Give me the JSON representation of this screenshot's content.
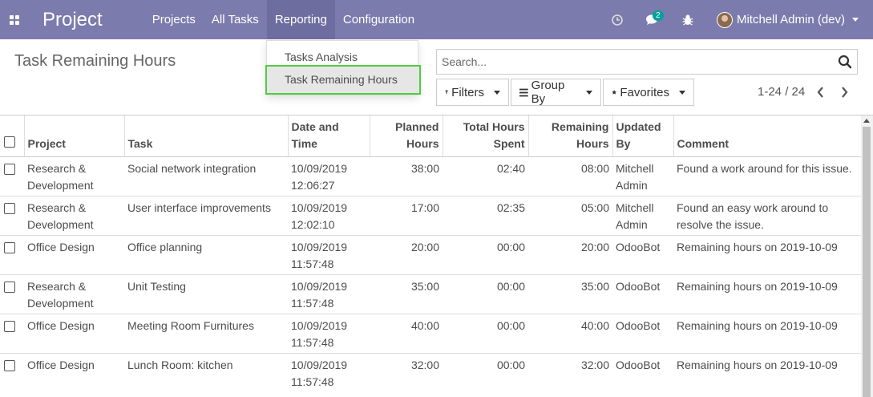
{
  "navbar": {
    "brand": "Project",
    "menu": [
      "Projects",
      "All Tasks",
      "Reporting",
      "Configuration"
    ],
    "chat_badge": "2",
    "user_name": "Mitchell Admin (dev)"
  },
  "reporting_menu": {
    "items": [
      "Tasks Analysis",
      "Task Remaining Hours"
    ]
  },
  "control_panel": {
    "title": "Task Remaining Hours",
    "search_placeholder": "Search...",
    "filters": "Filters",
    "group_by": "Group By",
    "favorites": "Favorites",
    "pager": "1-24 / 24"
  },
  "table": {
    "headers": {
      "project": "Project",
      "task": "Task",
      "date": "Date and Time",
      "planned": "Planned Hours",
      "spent": "Total Hours Spent",
      "remaining": "Remaining Hours",
      "updated": "Updated By",
      "comment": "Comment"
    },
    "rows": [
      {
        "project": "Research & Development",
        "task": "Social network integration",
        "date": "10/09/2019 12:06:27",
        "planned": "38:00",
        "spent": "02:40",
        "remaining": "08:00",
        "updated": "Mitchell Admin",
        "comment": "Found a work around for this issue."
      },
      {
        "project": "Research & Development",
        "task": "User interface improvements",
        "date": "10/09/2019 12:02:10",
        "planned": "17:00",
        "spent": "02:35",
        "remaining": "05:00",
        "updated": "Mitchell Admin",
        "comment": "Found an easy work around to resolve the issue."
      },
      {
        "project": "Office Design",
        "task": "Office planning",
        "date": "10/09/2019 11:57:48",
        "planned": "20:00",
        "spent": "00:00",
        "remaining": "20:00",
        "updated": "OdooBot",
        "comment": "Remaining hours on 2019-10-09"
      },
      {
        "project": "Research & Development",
        "task": "Unit Testing",
        "date": "10/09/2019 11:57:48",
        "planned": "35:00",
        "spent": "00:00",
        "remaining": "35:00",
        "updated": "OdooBot",
        "comment": "Remaining hours on 2019-10-09"
      },
      {
        "project": "Office Design",
        "task": "Meeting Room Furnitures",
        "date": "10/09/2019 11:57:48",
        "planned": "40:00",
        "spent": "00:00",
        "remaining": "40:00",
        "updated": "OdooBot",
        "comment": "Remaining hours on 2019-10-09"
      },
      {
        "project": "Office Design",
        "task": "Lunch Room: kitchen",
        "date": "10/09/2019 11:57:48",
        "planned": "32:00",
        "spent": "00:00",
        "remaining": "32:00",
        "updated": "OdooBot",
        "comment": "Remaining hours on 2019-10-09"
      }
    ]
  },
  "colors": {
    "navbar": "#7c7bad",
    "highlight_outline": "#4ece3f"
  }
}
